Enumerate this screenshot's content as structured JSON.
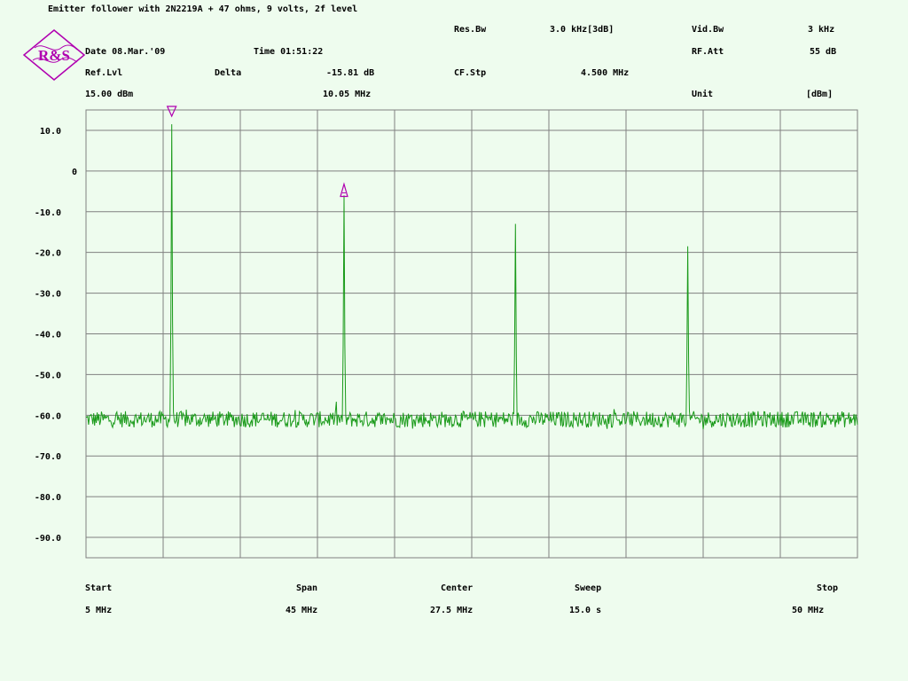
{
  "header": {
    "title": "Emitter follower with 2N2219A + 47 ohms, 9 volts, 2f level",
    "logo_text": "R&S",
    "res_bw_label": "Res.Bw",
    "res_bw_value": "3.0 kHz[3dB]",
    "vid_bw_label": "Vid.Bw",
    "vid_bw_value": "3 kHz",
    "date": "Date 08.Mar.'09",
    "time": "Time 01:51:22",
    "rf_att_label": "RF.Att",
    "rf_att_value": "55 dB",
    "ref_lvl_label": "Ref.Lvl",
    "ref_lvl_value": "15.00 dBm",
    "delta_label": "Delta",
    "delta_db": "-15.81 dB",
    "delta_freq": "10.05 MHz",
    "cf_stp_label": "CF.Stp",
    "cf_stp_value": "4.500 MHz",
    "unit_label": "Unit",
    "unit_value": "[dBm]"
  },
  "footer": {
    "start_label": "Start",
    "start_value": "5 MHz",
    "span_label": "Span",
    "span_value": "45 MHz",
    "center_label": "Center",
    "center_value": "27.5 MHz",
    "sweep_label": "Sweep",
    "sweep_value": "15.0 s",
    "stop_label": "Stop",
    "stop_value": "50 MHz"
  },
  "colors": {
    "trace": "#1a9a1a",
    "marker": "#b000b0",
    "grid": "#808080",
    "background": "#eefcee"
  },
  "chart_data": {
    "type": "line",
    "xlim": [
      5,
      50
    ],
    "ylim": [
      -95,
      15
    ],
    "yticks": [
      10,
      0,
      -10,
      -20,
      -30,
      -40,
      -50,
      -60,
      -70,
      -80,
      -90
    ],
    "ytick_labels": [
      "10.0",
      "0",
      "-10.0",
      "-20.0",
      "-30.0",
      "-40.0",
      "-50.0",
      "-60.0",
      "-70.0",
      "-80.0",
      "-90.0"
    ],
    "grid": true,
    "noise_floor": -61,
    "peaks": [
      {
        "x": 10.0,
        "y": 11.5
      },
      {
        "x": 20.05,
        "y": -6.0
      },
      {
        "x": 30.05,
        "y": -13.0
      },
      {
        "x": 40.1,
        "y": -18.5
      }
    ],
    "markers": [
      {
        "x": 10.0,
        "y": 15,
        "type": "down"
      },
      {
        "x": 20.05,
        "y": -4.5,
        "type": "delta"
      }
    ]
  }
}
